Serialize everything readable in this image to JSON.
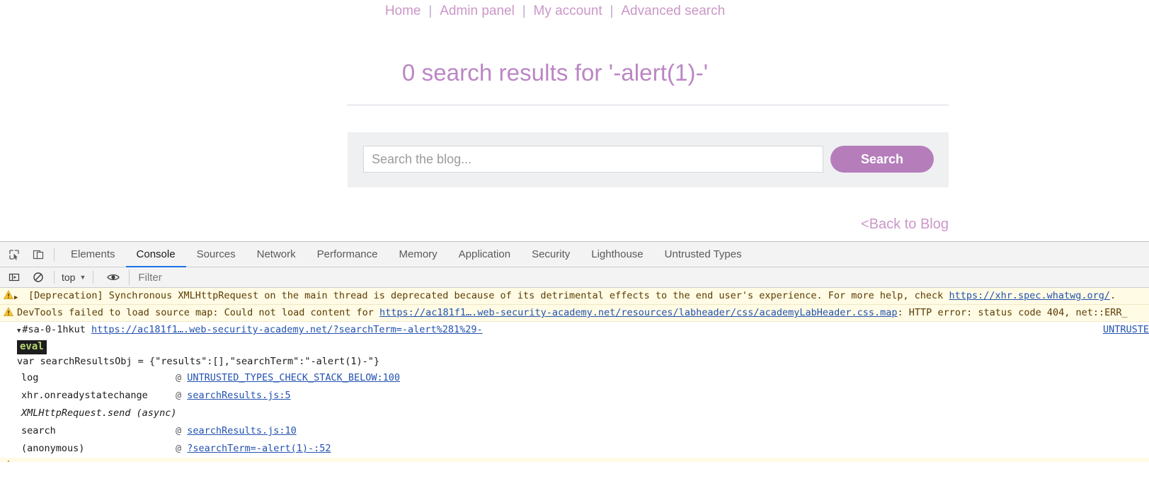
{
  "page": {
    "nav": {
      "items": [
        {
          "label": "Home"
        },
        {
          "label": "Admin panel"
        },
        {
          "label": "My account"
        },
        {
          "label": "Advanced search"
        }
      ],
      "separator": "|"
    },
    "results_title": "0 search results for '-alert(1)-'",
    "search": {
      "placeholder": "Search the blog...",
      "value": "",
      "button_label": "Search"
    },
    "back_link": "<Back to Blog",
    "colors": {
      "accent": "#bb86c4",
      "link": "#cb97c8",
      "button": "#b57ebb",
      "panel_bg": "#eff0f1"
    }
  },
  "devtools": {
    "toolbar": {
      "inspect_icon": "inspect-element-icon",
      "device_toolbar_icon": "device-toolbar-icon"
    },
    "tabs": [
      {
        "label": "Elements",
        "active": false
      },
      {
        "label": "Console",
        "active": true
      },
      {
        "label": "Sources",
        "active": false
      },
      {
        "label": "Network",
        "active": false
      },
      {
        "label": "Performance",
        "active": false
      },
      {
        "label": "Memory",
        "active": false
      },
      {
        "label": "Application",
        "active": false
      },
      {
        "label": "Security",
        "active": false
      },
      {
        "label": "Lighthouse",
        "active": false
      },
      {
        "label": "Untrusted Types",
        "active": false
      }
    ],
    "console_toolbar": {
      "sidebar_icon": "console-sidebar-icon",
      "clear_icon": "clear-console-icon",
      "context_label": "top",
      "context_caret": "▼",
      "eye_icon": "live-expression-eye-icon",
      "filter_placeholder": "Filter",
      "filter_value": ""
    },
    "messages": [
      {
        "kind": "warning",
        "icon": "warning-triangle-icon",
        "expand_caret": "▶",
        "text_before": "[Deprecation] Synchronous XMLHttpRequest on the main thread is deprecated because of its detrimental effects to the end user's experience. For more help, check ",
        "link": "https://xhr.spec.whatwg.org/",
        "text_after": "."
      },
      {
        "kind": "warning",
        "icon": "warning-triangle-icon",
        "text_before": "DevTools failed to load source map: Could not load content for ",
        "link": "https://ac181f1….web-security-academy.net/resources/labheader/css/academyLabHeader.css.map",
        "text_after": ": HTTP error: status code 404, net::ERR_"
      }
    ],
    "group": {
      "caret": "▼",
      "label": "#sa-0-1hkut",
      "url": "https://ac181f1….web-security-academy.net/?searchTerm=-alert%281%29-",
      "right_tag": "UNTRUSTE"
    },
    "eval_badge": "eval",
    "code_line": "var searchResultsObj = {\"results\":[],\"searchTerm\":\"-alert(1)-\"}",
    "stack": [
      {
        "fn": "log",
        "at": "@",
        "link": "UNTRUSTED_TYPES_CHECK_STACK_BELOW:100",
        "italic": false
      },
      {
        "fn": "xhr.onreadystatechange",
        "at": "@",
        "link": "searchResults.js:5",
        "italic": false
      },
      {
        "fn": "XMLHttpRequest.send (async)",
        "at": "",
        "link": "",
        "italic": true
      },
      {
        "fn": "search",
        "at": "@",
        "link": "searchResults.js:10",
        "italic": false
      },
      {
        "fn": "(anonymous)",
        "at": "@",
        "link": "?searchTerm=-alert(1)-:52",
        "italic": false
      }
    ]
  }
}
